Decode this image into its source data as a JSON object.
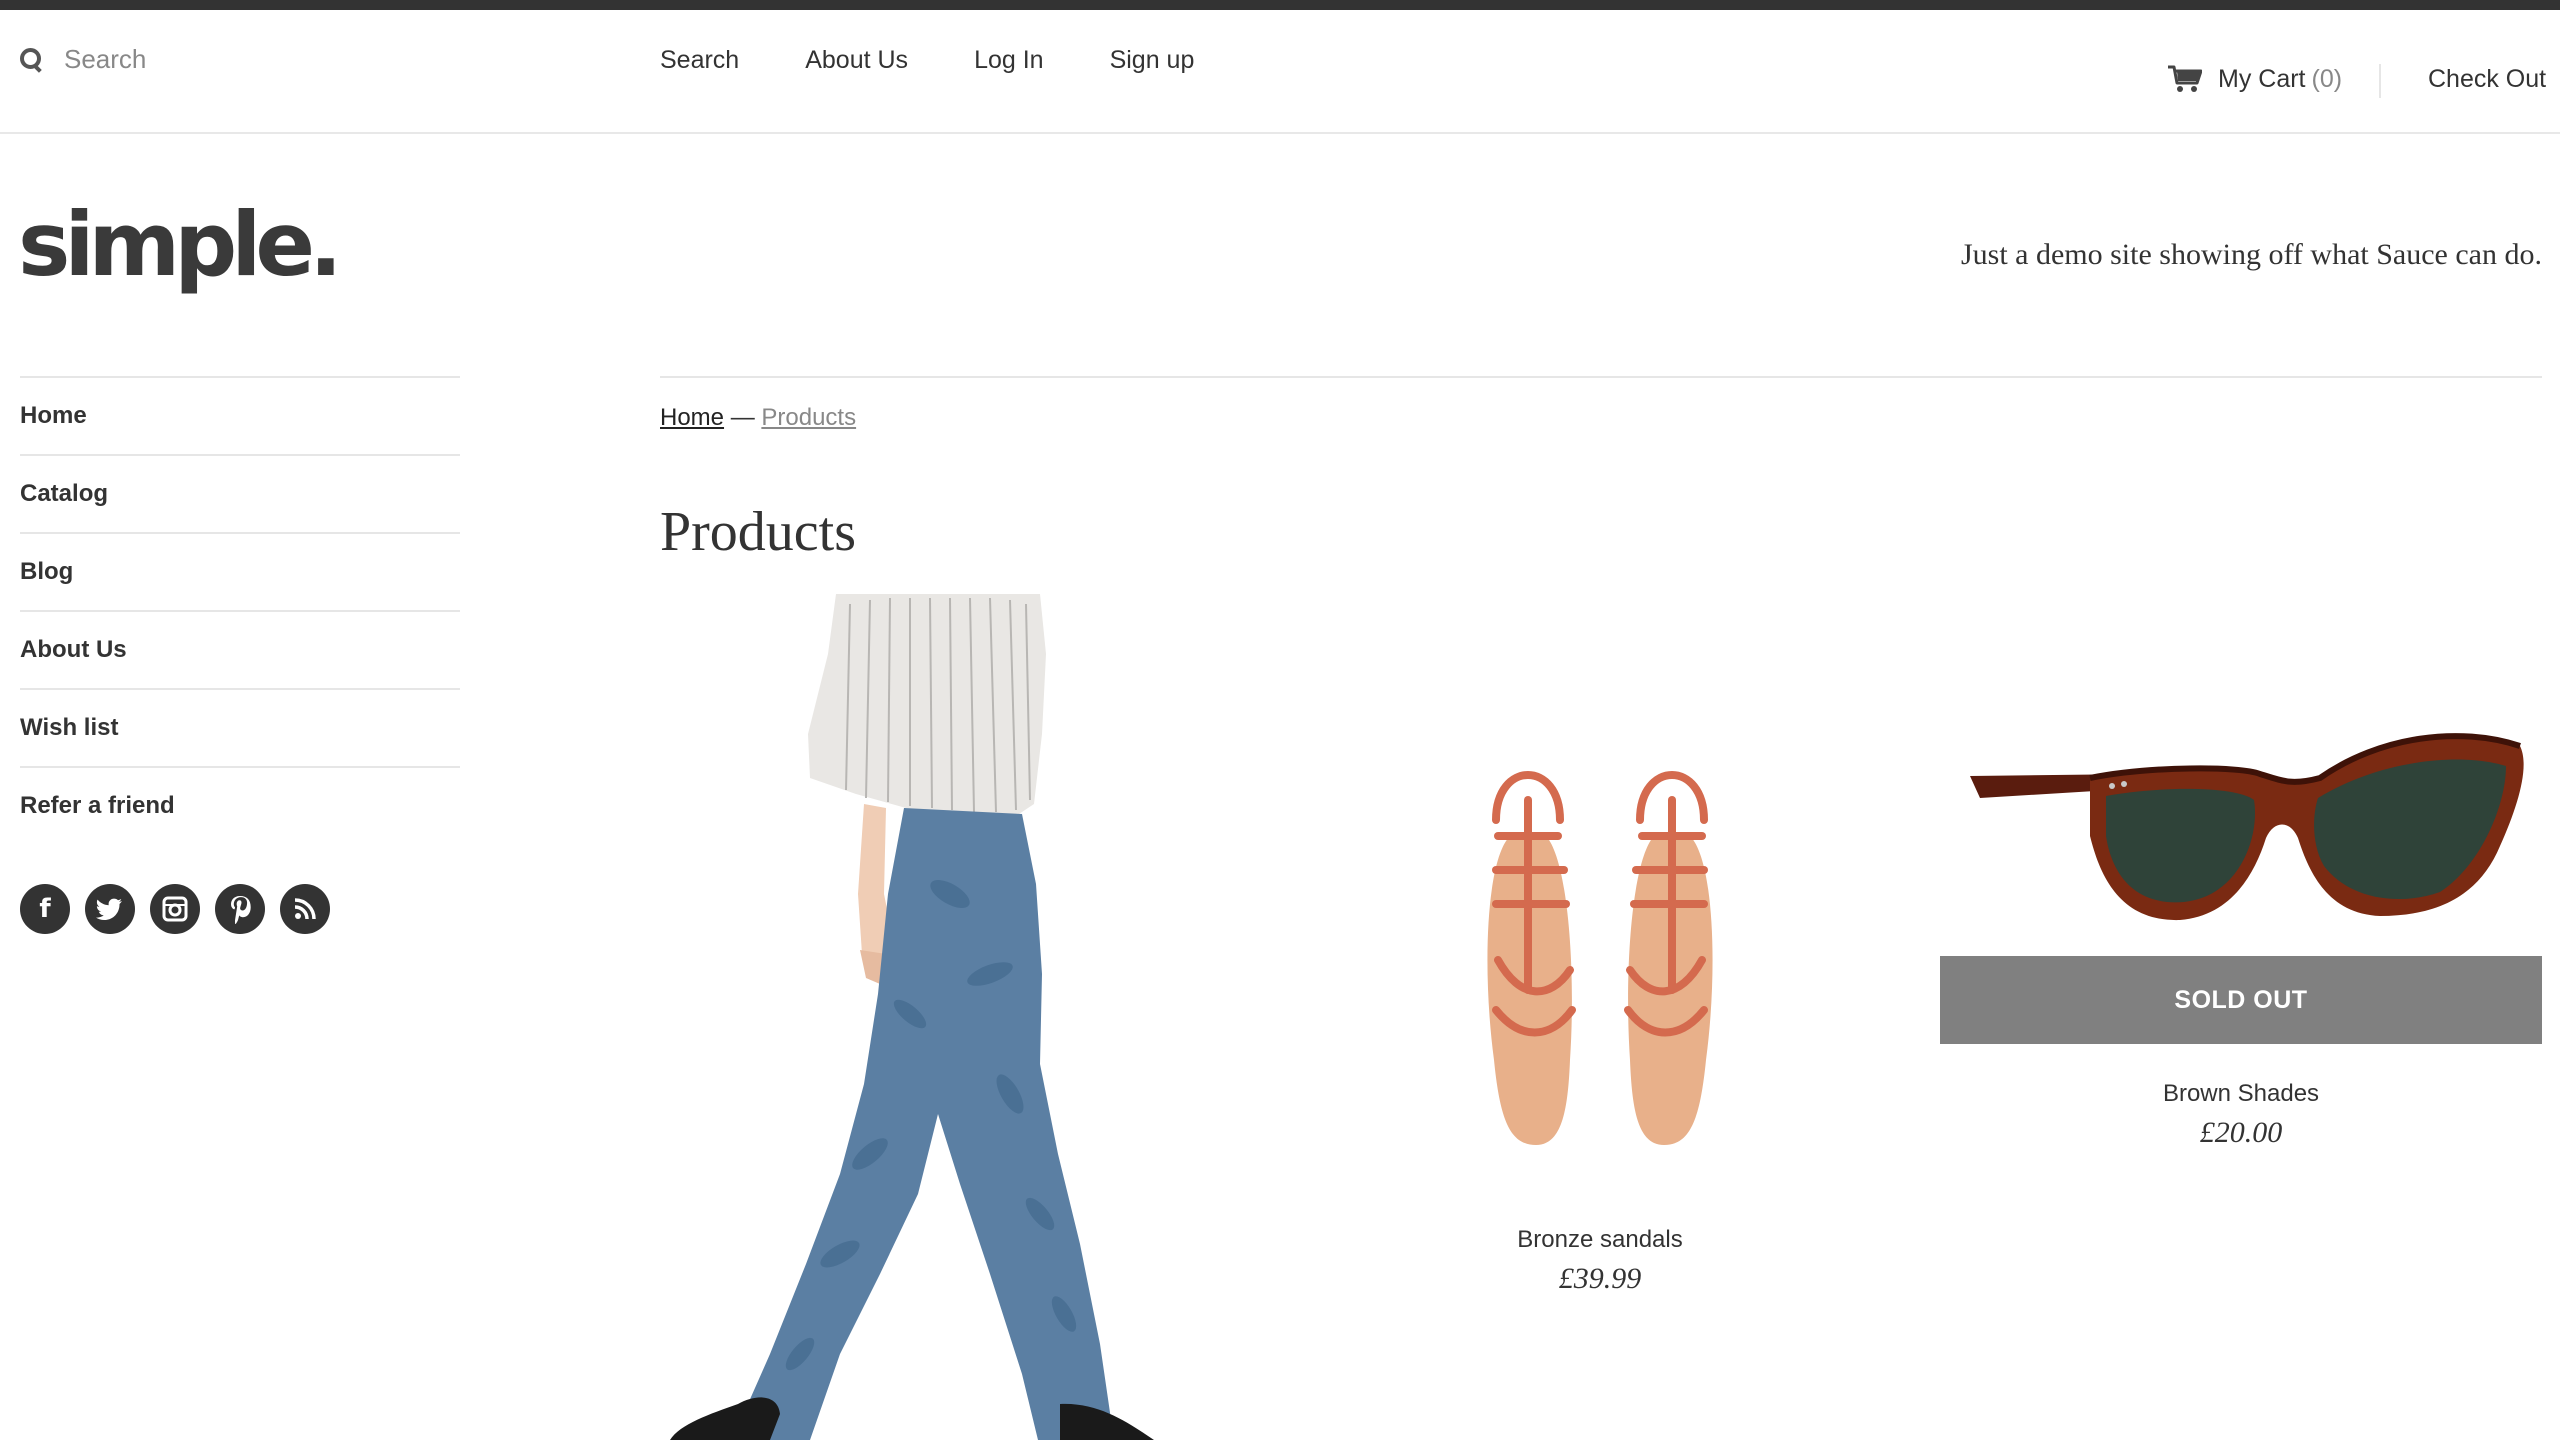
{
  "header": {
    "search": {
      "placeholder": "Search",
      "value": ""
    },
    "nav": [
      "Search",
      "About Us",
      "Log In",
      "Sign up"
    ],
    "cart": {
      "label": "My Cart",
      "count": "(0)"
    },
    "checkout": "Check Out"
  },
  "brand": {
    "logo": "simple.",
    "tagline": "Just a demo site showing off what Sauce can do."
  },
  "sidebar": {
    "items": [
      "Home",
      "Catalog",
      "Blog",
      "About Us",
      "Wish list",
      "Refer a friend"
    ],
    "social": [
      "facebook-icon",
      "twitter-icon",
      "instagram-icon",
      "pinterest-icon",
      "rss-icon"
    ]
  },
  "breadcrumb": {
    "home": "Home",
    "separator": " — ",
    "current": "Products"
  },
  "page": {
    "title": "Products"
  },
  "products": [
    {
      "image": "jeans-photo"
    },
    {
      "name": "Bronze sandals",
      "price": "£39.99",
      "image": "sandals-photo"
    },
    {
      "name": "Brown Shades",
      "price": "£20.00",
      "badge": "SOLD OUT",
      "image": "sunglasses-photo"
    }
  ],
  "colors": {
    "topbar": "#333333",
    "sold_out_bg": "#808080",
    "text": "#333333",
    "muted": "#888888"
  }
}
